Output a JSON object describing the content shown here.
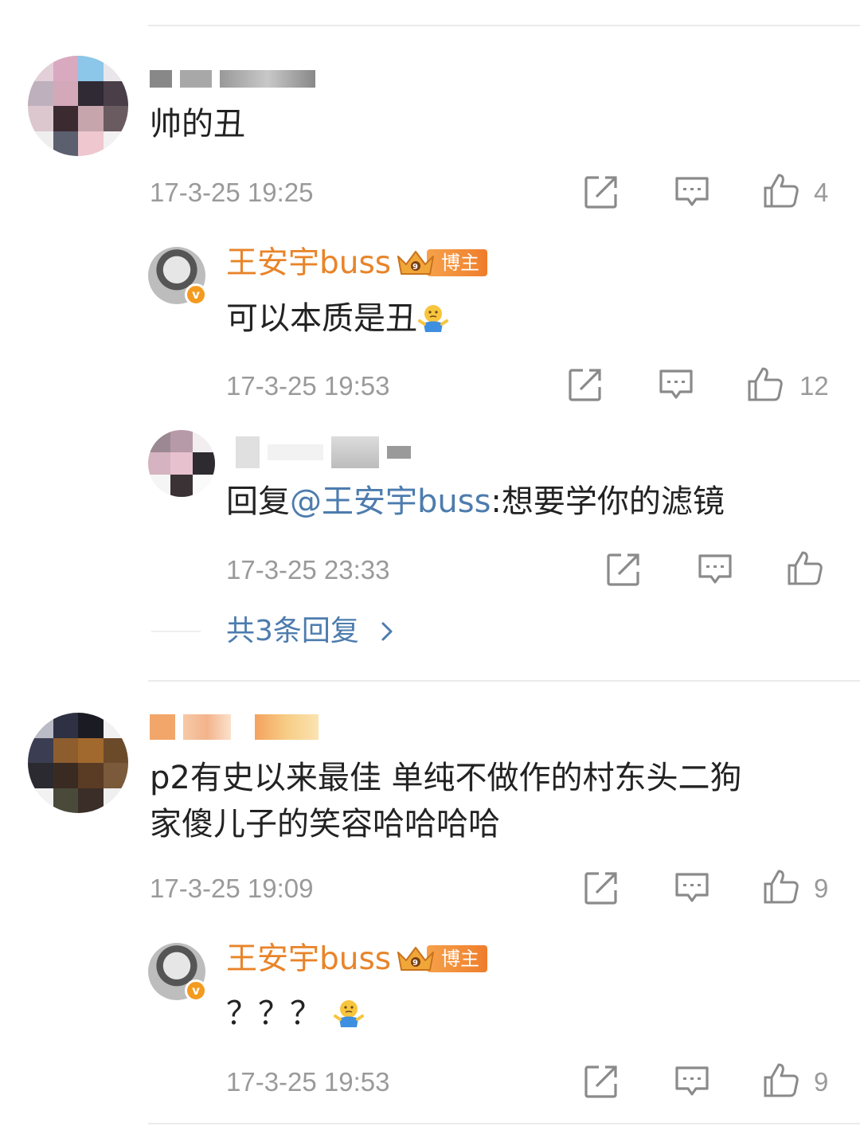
{
  "comments": [
    {
      "text": "帅的丑",
      "time": "17-3-25 19:25",
      "like_count": "4",
      "replies": [
        {
          "author": "王安宇buss",
          "badge": "博主",
          "text": "可以本质是丑",
          "time": "17-3-25 19:53",
          "like_count": "12"
        },
        {
          "prefix": "回复",
          "mention": "@王安宇buss",
          "text": ":想要学你的滤镜",
          "time": "17-3-25 23:33",
          "like_count": ""
        }
      ],
      "more_replies": "共3条回复"
    },
    {
      "text_line1": "p2有史以来最佳 单纯不做作的村东头二狗",
      "text_line2": "家傻儿子的笑容哈哈哈哈",
      "time": "17-3-25 19:09",
      "like_count": "9",
      "replies": [
        {
          "author": "王安宇buss",
          "badge": "博主",
          "text": "？？？",
          "time": "17-3-25 19:53",
          "like_count": "9"
        }
      ]
    }
  ],
  "colors": {
    "author": "#e8842a",
    "mention": "#4d7cae",
    "meta": "#9a9a9a"
  },
  "icons": [
    "repost-icon",
    "comment-icon",
    "like-icon",
    "chevron-right-icon",
    "shrug-emoji-icon",
    "crown-icon",
    "verified-icon"
  ]
}
